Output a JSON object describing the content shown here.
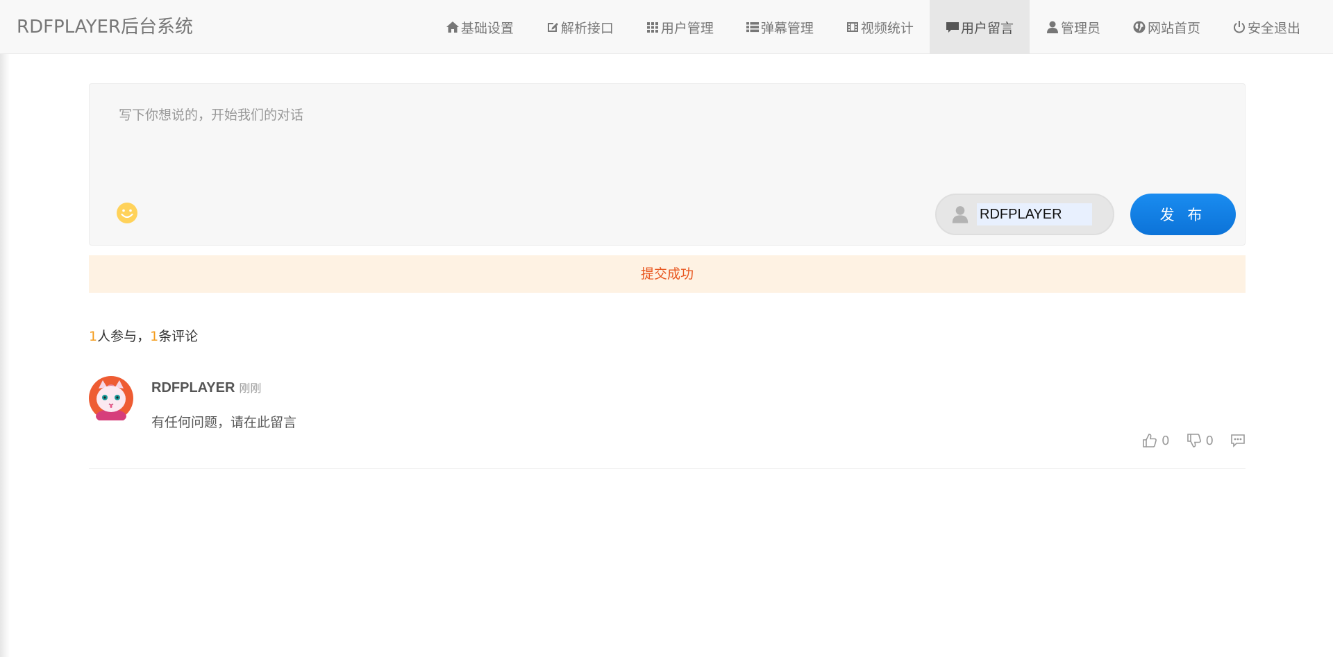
{
  "app": {
    "brand": "RDFPLAYER后台系统"
  },
  "nav": {
    "items": [
      {
        "label": "基础设置",
        "icon": "home-icon"
      },
      {
        "label": "解析接口",
        "icon": "edit-icon"
      },
      {
        "label": "用户管理",
        "icon": "grid-icon"
      },
      {
        "label": "弹幕管理",
        "icon": "list-icon"
      },
      {
        "label": "视频统计",
        "icon": "film-icon"
      },
      {
        "label": "用户留言",
        "icon": "comment-icon",
        "active": true
      },
      {
        "label": "管理员",
        "icon": "user-icon"
      },
      {
        "label": "网站首页",
        "icon": "globe-icon"
      },
      {
        "label": "安全退出",
        "icon": "power-icon"
      }
    ]
  },
  "composer": {
    "placeholder": "写下你想说的，开始我们的对话",
    "nickname": "RDFPLAYER",
    "publish_label": "发 布"
  },
  "alert": {
    "message": "提交成功"
  },
  "stats": {
    "participants": "1",
    "participants_label": "人参与，",
    "comments": "1",
    "comments_label": "条评论"
  },
  "comments": [
    {
      "author": "RDFPLAYER",
      "time": "刚刚",
      "text": "有任何问题，请在此留言",
      "likes": "0",
      "dislikes": "0"
    }
  ],
  "colors": {
    "accent": "#1a8cf0",
    "count": "#f49b1a",
    "alert_text": "#e8551e",
    "alert_bg": "#fef2e3"
  }
}
